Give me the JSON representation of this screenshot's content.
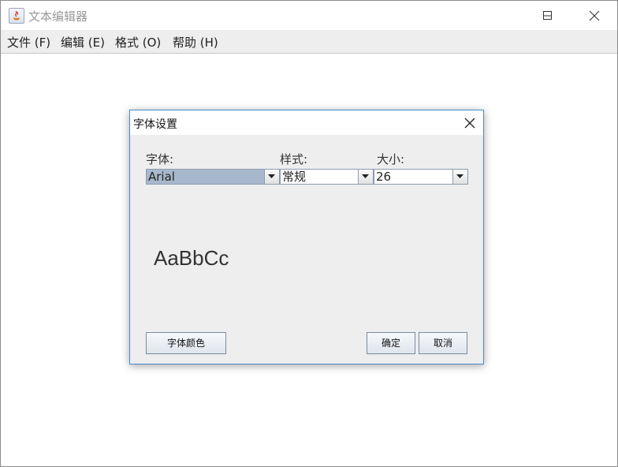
{
  "window": {
    "title": "文本编辑器",
    "menu": [
      {
        "label": "文件 (F)"
      },
      {
        "label": "编辑 (E)"
      },
      {
        "label": "格式 (O)"
      },
      {
        "label": "帮助 (H)"
      }
    ]
  },
  "dialog": {
    "title": "字体设置",
    "font_label": "字体:",
    "style_label": "样式:",
    "size_label": "大小:",
    "font_value": "Arial",
    "style_value": "常规",
    "size_value": "26",
    "preview_text": "AaBbCc",
    "color_button": "字体颜色",
    "ok_button": "确定",
    "cancel_button": "取消"
  }
}
